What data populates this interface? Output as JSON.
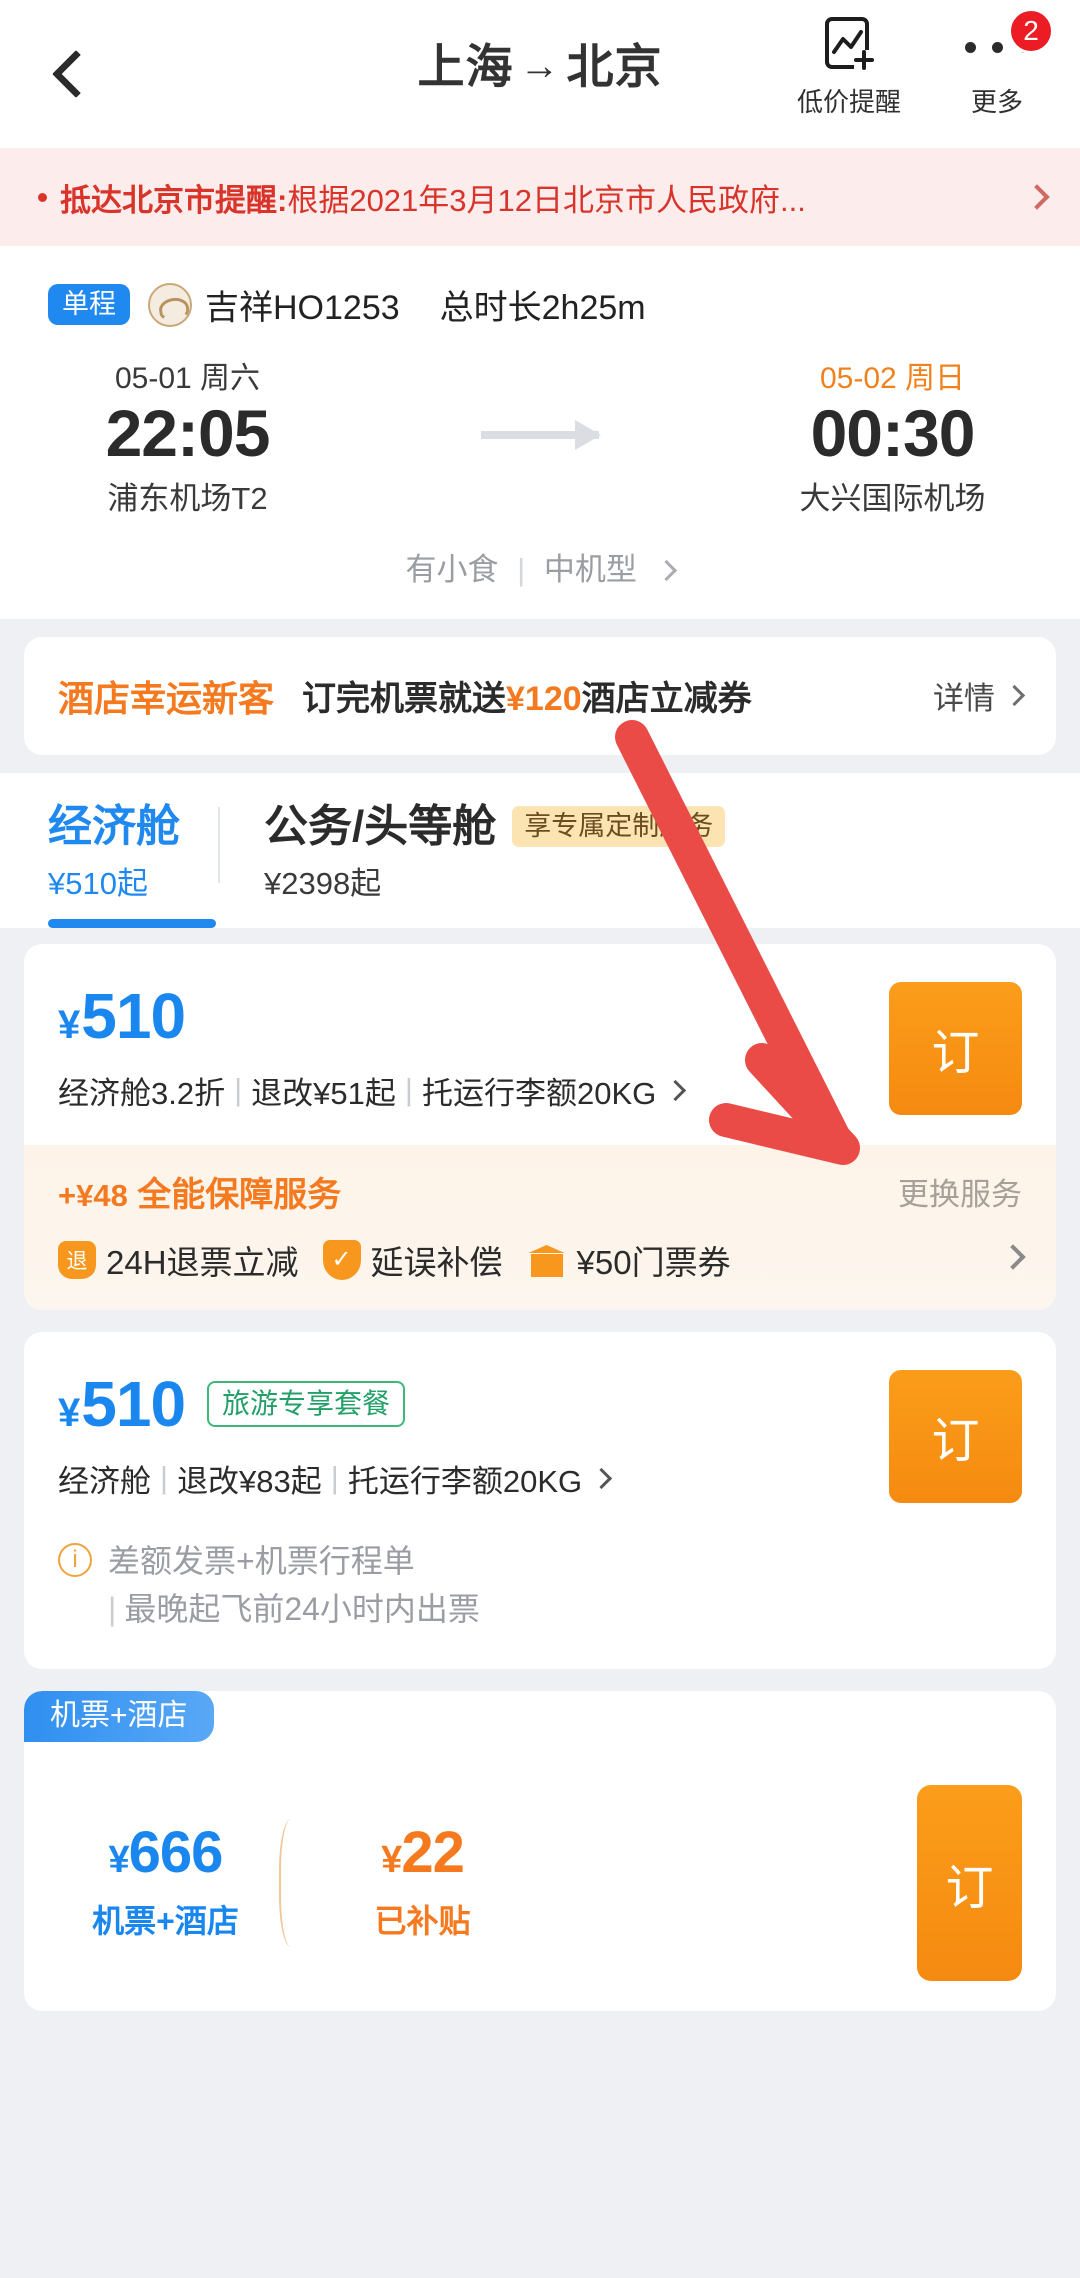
{
  "header": {
    "back_icon": "chevron-left-icon",
    "title_from": "上海",
    "title_arrow": "→",
    "title_to": "北京",
    "price_alert_label": "低价提醒",
    "price_alert_icon": "chart-add-icon",
    "more_label": "更多",
    "more_icon": "ellipsis-icon",
    "more_badge": "2"
  },
  "notice": {
    "bold": "抵达北京市提醒:",
    "text": "根据2021年3月12日北京市人民政府...",
    "chevron": "›"
  },
  "flight": {
    "trip_tag": "单程",
    "airline_logo": "juneyao-air-logo",
    "flight_no": "吉祥HO1253",
    "duration": "总时长2h25m",
    "depart": {
      "date": "05-01 周六",
      "time": "22:05",
      "airport": "浦东机场T2"
    },
    "arrive": {
      "date": "05-02 周日",
      "time": "00:30",
      "airport": "大兴国际机场"
    },
    "meta_snack": "有小食",
    "meta_divider": "|",
    "meta_aircraft": "中机型",
    "meta_chevron": "›"
  },
  "promo": {
    "title": "酒店幸运新客",
    "text_pre": "订完机票就送",
    "text_amount": "¥120",
    "text_post": "酒店立减券",
    "more": "详情"
  },
  "cabin_tabs": [
    {
      "name": "经济舱",
      "price": "¥510起",
      "active": true,
      "badge": ""
    },
    {
      "name": "公务/头等舱",
      "price": "¥2398起",
      "active": false,
      "badge": "享专属定制服务"
    }
  ],
  "fares": [
    {
      "price_yen": "¥",
      "price_value": "510",
      "badge": "",
      "detail": [
        "经济舱3.2折",
        "退改¥51起",
        "托运行李额20KG"
      ],
      "order_label": "订",
      "service": {
        "plus": "+¥48",
        "title": "全能保障服务",
        "change": "更换服务",
        "items": [
          {
            "icon": "refund-icon",
            "glyph": "退",
            "label": "24H退票立减"
          },
          {
            "icon": "shield-check-icon",
            "glyph": "✓",
            "label": "延误补偿"
          },
          {
            "icon": "ticket-voucher-icon",
            "glyph": "",
            "label": "¥50门票券"
          }
        ]
      }
    },
    {
      "price_yen": "¥",
      "price_value": "510",
      "badge": "旅游专享套餐",
      "detail": [
        "经济舱",
        "退改¥83起",
        "托运行李额20KG"
      ],
      "order_label": "订",
      "info_lines": [
        "差额发票+机票行程单",
        "最晚起飞前24小时内出票"
      ]
    }
  ],
  "combo": {
    "corner_tag": "机票+酒店",
    "left_price_yen": "¥",
    "left_price": "666",
    "left_label": "机票+酒店",
    "right_price_yen": "¥",
    "right_price": "22",
    "right_label": "已补贴",
    "order_label": "订"
  },
  "annotation": {
    "type": "arrow",
    "color": "#ea4b47"
  },
  "colors": {
    "brand_blue": "#2089f0",
    "accent_orange": "#f4791f",
    "order_button": "#f7971d",
    "notice_red": "#d8342a",
    "green_badge": "#3cb878"
  }
}
